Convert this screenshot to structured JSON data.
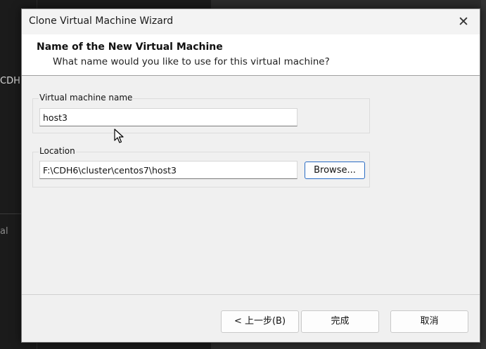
{
  "background": {
    "text_top": "CDH",
    "text_bottom": "al"
  },
  "dialog": {
    "title": "Clone Virtual Machine Wizard",
    "close_icon": "close-icon",
    "header_title": "Name of the New Virtual Machine",
    "header_subtitle": "What name would you like to use for this virtual machine?",
    "name_group_label": "Virtual machine name",
    "name_value": "host3",
    "location_group_label": "Location",
    "location_value": "F:\\CDH6\\cluster\\centos7\\host3",
    "browse_label": "Browse...",
    "back_label": "< 上一步(B)",
    "finish_label": "完成",
    "cancel_label": "取消"
  },
  "colors": {
    "accent": "#2a6cc4",
    "dialog_bg": "#f0f0f0",
    "header_bg": "#ffffff"
  }
}
